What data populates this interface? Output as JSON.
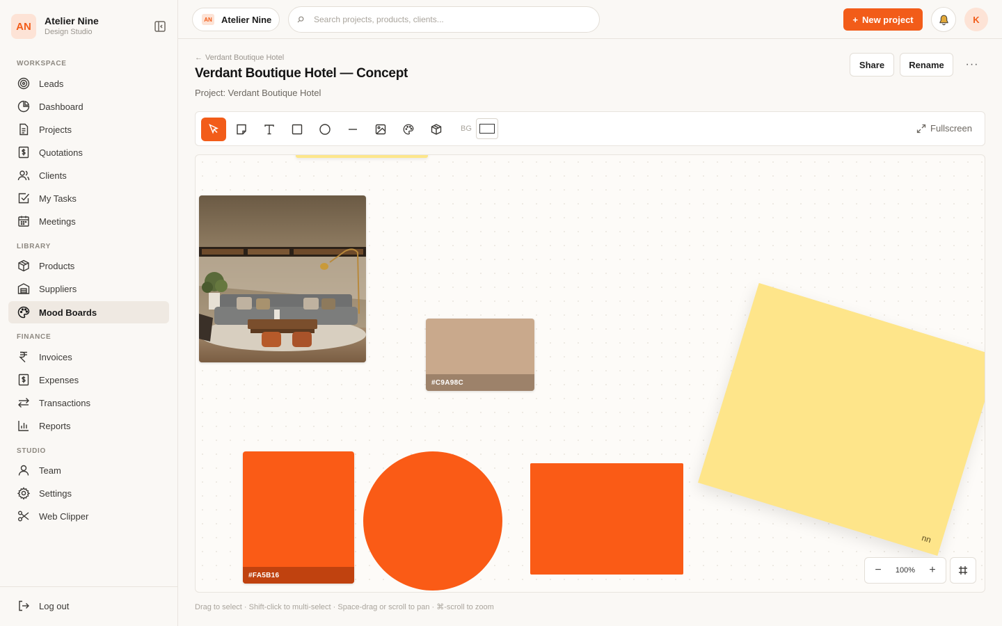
{
  "brand": {
    "initials": "AN",
    "name": "Atelier Nine",
    "subtitle": "Design Studio"
  },
  "sidebar": {
    "sections": [
      {
        "label": "WORKSPACE"
      },
      {
        "label": "LIBRARY"
      },
      {
        "label": "FINANCE"
      },
      {
        "label": "STUDIO"
      }
    ],
    "items": [
      {
        "label": "Leads",
        "icon": "target-icon"
      },
      {
        "label": "Dashboard",
        "icon": "pie-chart-icon"
      },
      {
        "label": "Projects",
        "icon": "document-icon"
      },
      {
        "label": "Quotations",
        "icon": "dollar-doc-icon"
      },
      {
        "label": "Clients",
        "icon": "users-icon"
      },
      {
        "label": "My Tasks",
        "icon": "checkbox-icon"
      },
      {
        "label": "Meetings",
        "icon": "calendar-icon"
      },
      {
        "label": "Products",
        "icon": "box-icon"
      },
      {
        "label": "Suppliers",
        "icon": "warehouse-icon"
      },
      {
        "label": "Mood Boards",
        "icon": "palette-icon",
        "active": true
      },
      {
        "label": "Invoices",
        "icon": "rupee-icon"
      },
      {
        "label": "Expenses",
        "icon": "dollar-doc-icon"
      },
      {
        "label": "Transactions",
        "icon": "arrows-icon"
      },
      {
        "label": "Reports",
        "icon": "bar-chart-icon"
      },
      {
        "label": "Team",
        "icon": "user-icon"
      },
      {
        "label": "Settings",
        "icon": "gear-icon"
      },
      {
        "label": "Web Clipper",
        "icon": "scissors-icon"
      }
    ],
    "logout": "Log out"
  },
  "topbar": {
    "workspace_initials": "AN",
    "workspace_name": "Atelier Nine",
    "search_placeholder": "Search projects, products, clients...",
    "new_project": "New project",
    "avatar_initial": "K"
  },
  "page": {
    "breadcrumb": "Verdant Boutique Hotel",
    "title": "Verdant Boutique Hotel — Concept",
    "subtitle": "Project: Verdant Boutique Hotel",
    "share": "Share",
    "rename": "Rename",
    "more": "···"
  },
  "toolbar": {
    "tools": [
      "select-tool",
      "note-tool",
      "text-tool",
      "rectangle-tool",
      "ellipse-tool",
      "line-tool",
      "image-tool",
      "palette-tool",
      "3d-box-tool"
    ],
    "bg_label": "BG",
    "fullscreen": "Fullscreen"
  },
  "canvas": {
    "swatch_tan": {
      "hex": "#C9A98C",
      "label": "#C9A98C"
    },
    "swatch_orange": {
      "hex": "#FA5B16",
      "label": "#FA5B16"
    },
    "sticky_text": "uu",
    "zoom_level": "100%",
    "zoom_out": "−",
    "zoom_in": "+"
  },
  "hint": "Drag to select · Shift-click to multi-select · Space-drag or scroll to pan · ⌘-scroll to zoom",
  "colors": {
    "accent": "#F25C19",
    "sticky": "#FEE58A",
    "active_nav": "#EFE9E2"
  }
}
